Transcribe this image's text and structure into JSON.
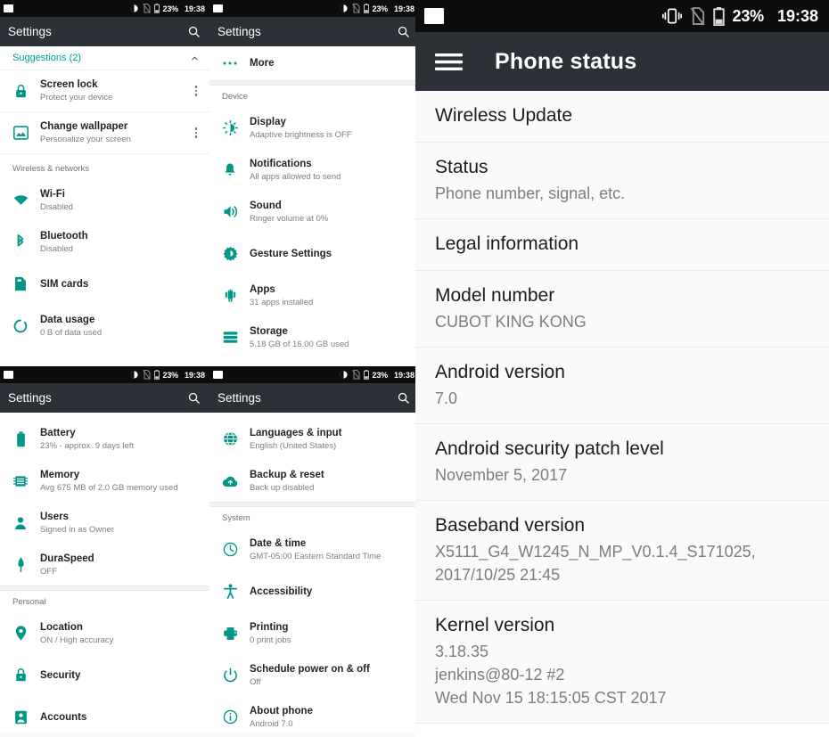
{
  "statusbar": {
    "photo_icon": "photo-icon",
    "vibrate_icon": "vibrate-icon",
    "no_sim_icon": "no-sim-icon",
    "battery_icon": "battery-icon",
    "battery_pct": "23%",
    "time": "19:38"
  },
  "colors": {
    "accent_teal": "#009688",
    "appbar": "#2c3137",
    "statusbar": "#0d0d0d",
    "suggestion_green": "#00a08a",
    "primary_text": "#1f2326",
    "secondary_text": "#7a7f83"
  },
  "panel1": {
    "appbar_title": "Settings",
    "search_icon": "search-icon",
    "suggestions": {
      "label": "Suggestions (2)",
      "collapse_icon": "chevron-up-icon",
      "items": [
        {
          "icon": "lock-icon",
          "title": "Screen lock",
          "subtitle": "Protect your device",
          "overflow_icon": "kebab-menu-icon"
        },
        {
          "icon": "wallpaper-icon",
          "title": "Change wallpaper",
          "subtitle": "Personalize your screen",
          "overflow_icon": "kebab-menu-icon"
        }
      ]
    },
    "section_label": "Wireless & networks",
    "items": [
      {
        "icon": "wifi-icon",
        "title": "Wi-Fi",
        "subtitle": "Disabled"
      },
      {
        "icon": "bluetooth-icon",
        "title": "Bluetooth",
        "subtitle": "Disabled"
      },
      {
        "icon": "sim-card-icon",
        "title": "SIM cards",
        "subtitle": ""
      },
      {
        "icon": "data-usage-icon",
        "title": "Data usage",
        "subtitle": "0 B of data used"
      }
    ]
  },
  "panel2": {
    "appbar_title": "Settings",
    "search_icon": "search-icon",
    "more_item": {
      "icon": "more-horizontal-icon",
      "title": "More",
      "subtitle": ""
    },
    "section_label": "Device",
    "items": [
      {
        "icon": "display-icon",
        "title": "Display",
        "subtitle": "Adaptive brightness is OFF"
      },
      {
        "icon": "notifications-bell-icon",
        "title": "Notifications",
        "subtitle": "All apps allowed to send"
      },
      {
        "icon": "sound-volume-icon",
        "title": "Sound",
        "subtitle": "Ringer volume at 0%"
      },
      {
        "icon": "gesture-gear-icon",
        "title": "Gesture Settings",
        "subtitle": ""
      },
      {
        "icon": "android-apps-icon",
        "title": "Apps",
        "subtitle": "31 apps installed"
      },
      {
        "icon": "storage-icon",
        "title": "Storage",
        "subtitle": "5.18 GB of 16.00 GB used"
      }
    ]
  },
  "panel3": {
    "appbar_title": "Settings",
    "search_icon": "search-icon",
    "items": [
      {
        "icon": "battery-icon",
        "title": "Battery",
        "subtitle": "23% - approx. 9 days left"
      },
      {
        "icon": "memory-icon",
        "title": "Memory",
        "subtitle": "Avg 675 MB of 2.0 GB memory used"
      },
      {
        "icon": "users-person-icon",
        "title": "Users",
        "subtitle": "Signed in as Owner"
      },
      {
        "icon": "duraspeed-icon",
        "title": "DuraSpeed",
        "subtitle": "OFF"
      }
    ],
    "section_label": "Personal",
    "items2": [
      {
        "icon": "location-pin-icon",
        "title": "Location",
        "subtitle": "ON / High accuracy"
      },
      {
        "icon": "lock-icon",
        "title": "Security",
        "subtitle": ""
      },
      {
        "icon": "accounts-badge-icon",
        "title": "Accounts",
        "subtitle": ""
      }
    ]
  },
  "panel4": {
    "appbar_title": "Settings",
    "search_icon": "search-icon",
    "items": [
      {
        "icon": "globe-language-icon",
        "title": "Languages & input",
        "subtitle": "English (United States)"
      },
      {
        "icon": "backup-cloud-icon",
        "title": "Backup & reset",
        "subtitle": "Back up disabled"
      }
    ],
    "section_label": "System",
    "items2": [
      {
        "icon": "clock-icon",
        "title": "Date & time",
        "subtitle": "GMT-05:00 Eastern Standard Time"
      },
      {
        "icon": "accessibility-icon",
        "title": "Accessibility",
        "subtitle": ""
      },
      {
        "icon": "printer-icon",
        "title": "Printing",
        "subtitle": "0 print jobs"
      },
      {
        "icon": "power-icon",
        "title": "Schedule power on & off",
        "subtitle": "Off"
      },
      {
        "icon": "info-icon",
        "title": "About phone",
        "subtitle": "Android 7.0"
      }
    ]
  },
  "panel_big": {
    "menu_icon": "hamburger-menu-icon",
    "appbar_title": "Phone status",
    "items": [
      {
        "title": "Wireless Update",
        "subtitle": ""
      },
      {
        "title": "Status",
        "subtitle": "Phone number, signal, etc."
      },
      {
        "title": "Legal information",
        "subtitle": ""
      },
      {
        "title": "Model number",
        "subtitle": "CUBOT KING KONG"
      },
      {
        "title": "Android version",
        "subtitle": "7.0"
      },
      {
        "title": "Android security patch level",
        "subtitle": "November 5, 2017"
      },
      {
        "title": "Baseband version",
        "subtitle": "X5111_G4_W1245_N_MP_V0.1.4_S171025,\n2017/10/25 21:45"
      },
      {
        "title": "Kernel version",
        "subtitle": "3.18.35\njenkins@80-12 #2\nWed Nov 15 18:15:05 CST 2017"
      }
    ]
  }
}
